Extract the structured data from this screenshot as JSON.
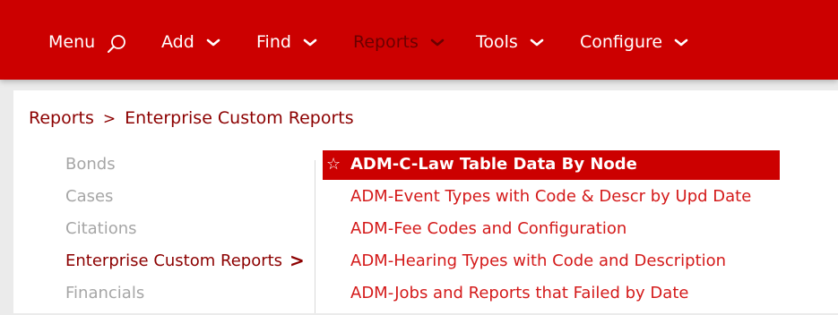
{
  "nav": {
    "menu_label": "Menu",
    "add_label": "Add",
    "find_label": "Find",
    "reports_label": "Reports",
    "tools_label": "Tools",
    "configure_label": "Configure"
  },
  "breadcrumb": {
    "root": "Reports",
    "separator": ">",
    "current": "Enterprise Custom Reports"
  },
  "categories": [
    {
      "label": "Bonds"
    },
    {
      "label": "Cases"
    },
    {
      "label": "Citations"
    },
    {
      "label": "Enterprise Custom Reports",
      "active": true
    },
    {
      "label": "Financials"
    }
  ],
  "category_arrow": ">",
  "reports": [
    {
      "label": "ADM-C-Law Table Data By Node",
      "selected": true
    },
    {
      "label": "ADM-Event Types with Code & Descr by Upd Date"
    },
    {
      "label": "ADM-Fee Codes and Configuration"
    },
    {
      "label": "ADM-Hearing Types with Code and Description"
    },
    {
      "label": "ADM-Jobs and Reports that Failed by Date"
    }
  ],
  "colors": {
    "brand_red": "#cc0000",
    "dark_red": "#8c0000",
    "link_red": "#d41a1a",
    "muted": "#a6a6a6"
  },
  "icons": {
    "menu": "search-icon",
    "dropdown": "chevron-down-icon",
    "favorite": "star-outline-icon"
  }
}
